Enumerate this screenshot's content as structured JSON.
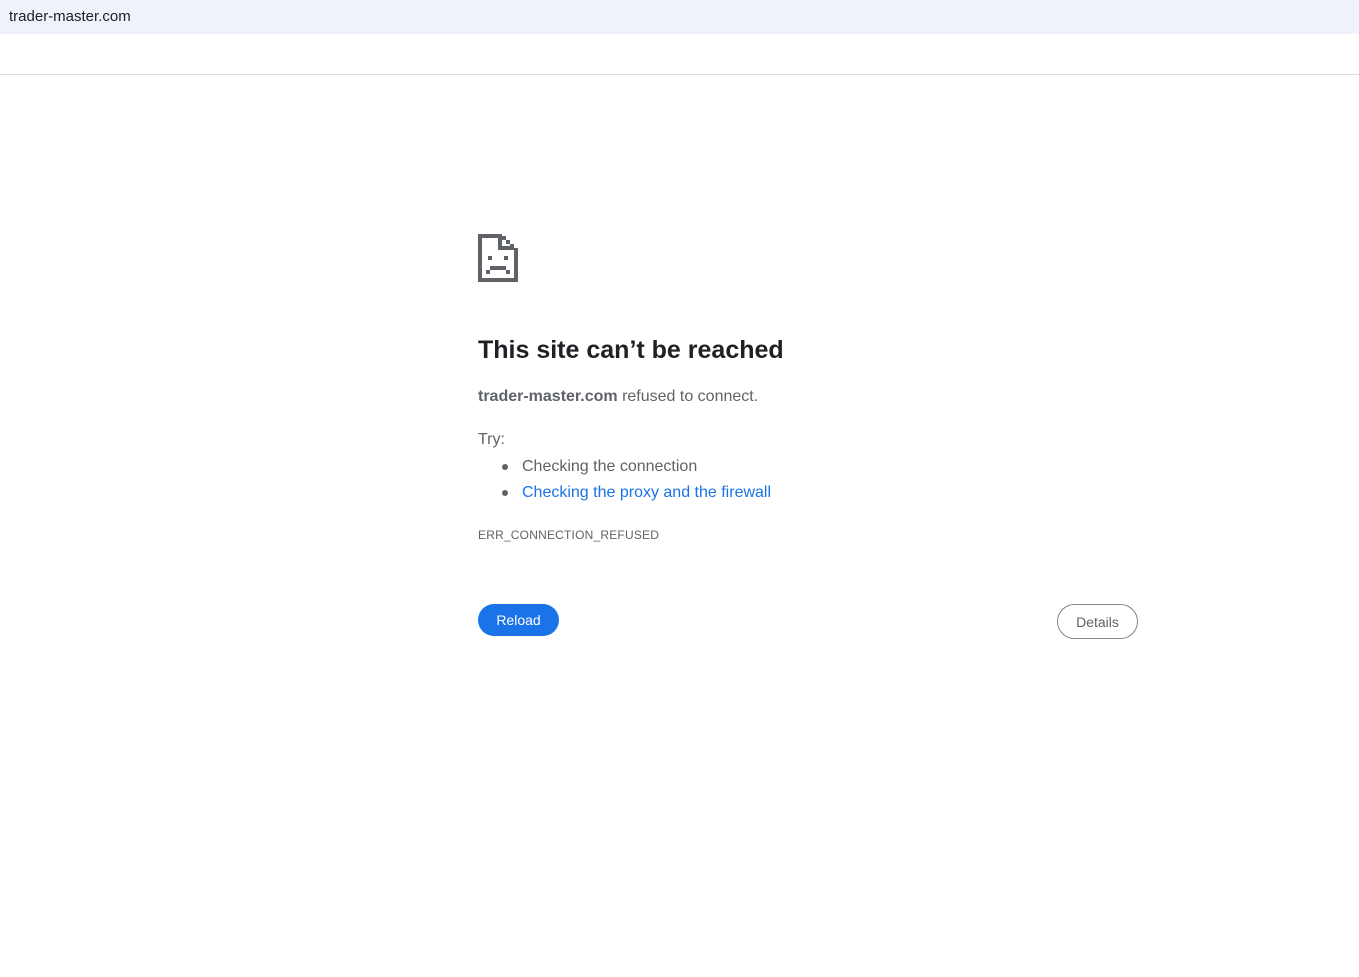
{
  "address_bar": {
    "url": "trader-master.com"
  },
  "error_page": {
    "icon": "sad-page-icon",
    "title": "This site can’t be reached",
    "host": "trader-master.com",
    "message_suffix": " refused to connect.",
    "try_label": "Try:",
    "suggestions": [
      {
        "text": "Checking the connection",
        "is_link": false
      },
      {
        "text": "Checking the proxy and the firewall",
        "is_link": true
      }
    ],
    "error_code": "ERR_CONNECTION_REFUSED",
    "reload_label": "Reload",
    "details_label": "Details",
    "colors": {
      "accent": "#1a73e8",
      "text_secondary": "#5f6368",
      "title": "#202124",
      "address_bar_bg": "#eef2fa"
    }
  }
}
